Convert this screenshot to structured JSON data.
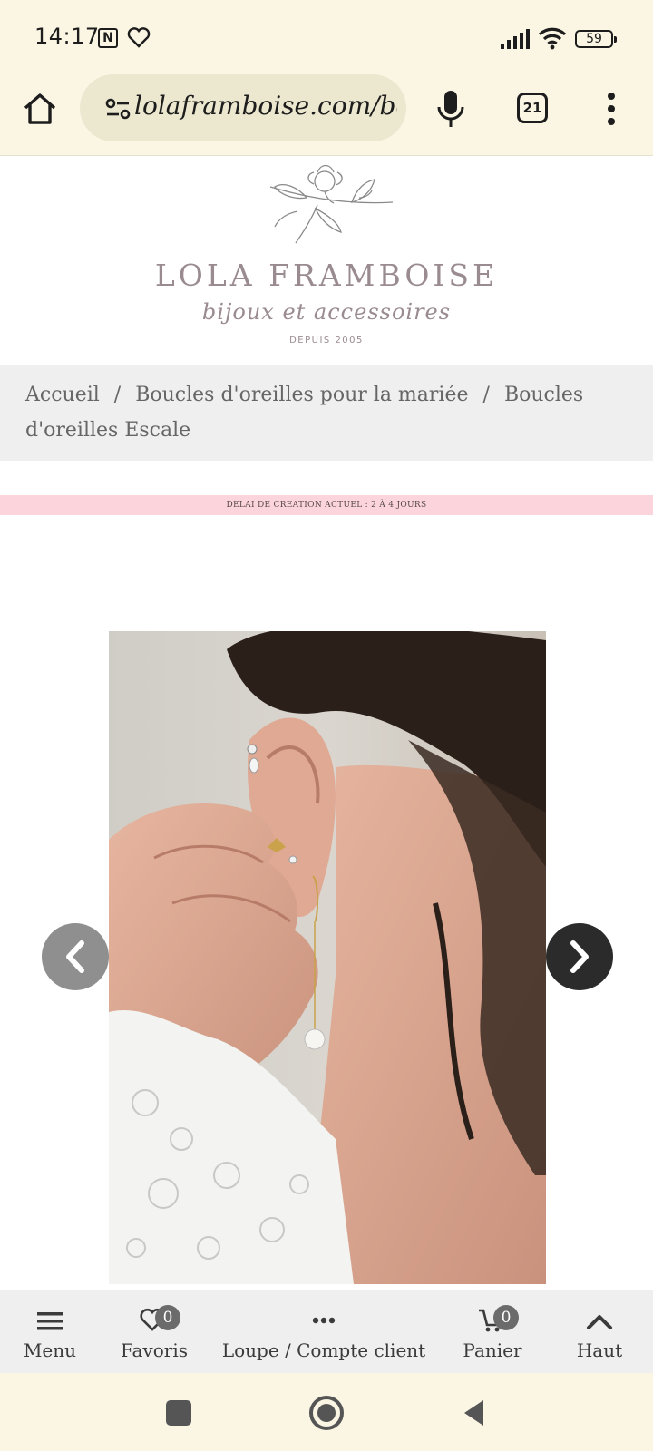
{
  "status_bar": {
    "time": "14:17",
    "nfc_label": "N",
    "battery": "59"
  },
  "browser": {
    "url": "lolaframboise.com/bo",
    "tab_count": "21"
  },
  "logo": {
    "name": "LOLA FRAMBOISE",
    "tagline": "bijoux et accessoires",
    "since": "DEPUIS 2005"
  },
  "breadcrumb": {
    "items": [
      "Accueil",
      "Boucles d'oreilles pour la mariée",
      "Boucles d'oreilles Escale"
    ],
    "separator": "/"
  },
  "notice": {
    "text": "DELAI DE CREATION ACTUEL : 2 À 4 JOURS",
    "color": "#fbd4dc"
  },
  "product": {
    "image_alt": "Boucles d'oreilles Escale"
  },
  "site_nav": {
    "menu": "Menu",
    "favorites": "Favoris",
    "favorites_count": "0",
    "search_account": "Loupe / Compte client",
    "cart": "Panier",
    "cart_count": "0",
    "top": "Haut"
  }
}
